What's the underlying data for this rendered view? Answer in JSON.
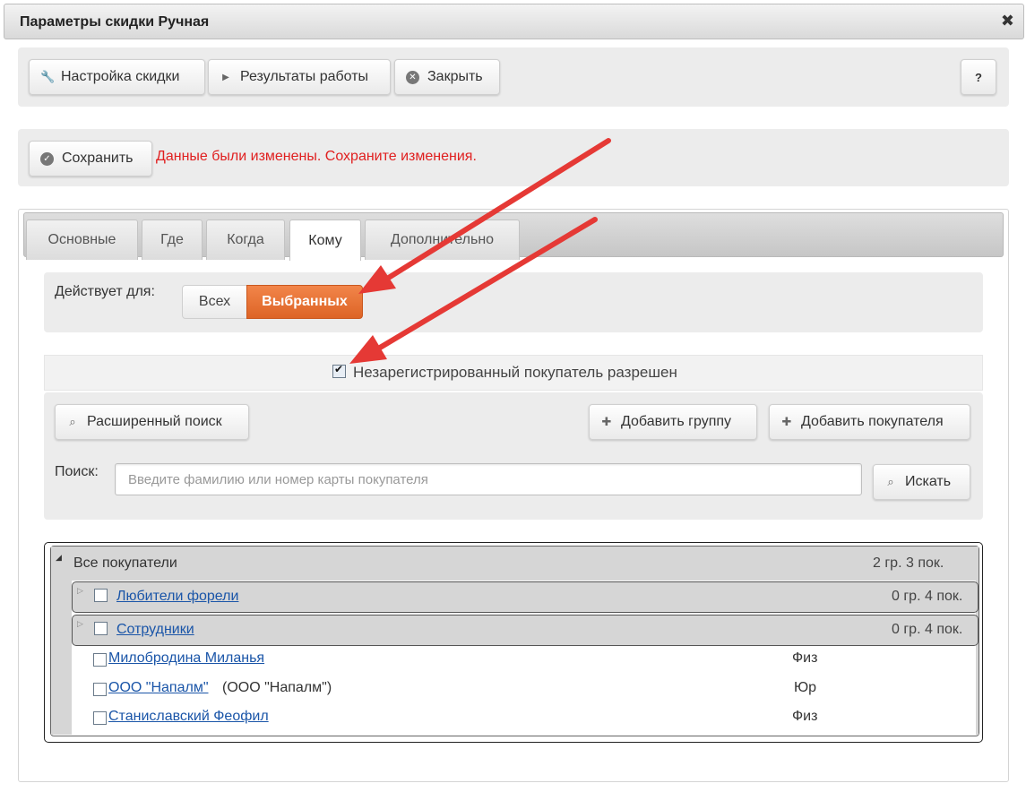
{
  "window": {
    "title": "Параметры скидки Ручная",
    "close_icon": "✖"
  },
  "toolbar": {
    "settings_label": "Настройка скидки",
    "results_label": "Результаты работы",
    "close_label": "Закрыть",
    "help_label": "?"
  },
  "save_bar": {
    "save_label": "Сохранить",
    "notice": "Данные были изменены. Сохраните изменения.",
    "notice_color": "#e02020"
  },
  "tabs": [
    {
      "label": "Основные",
      "active": false
    },
    {
      "label": "Где",
      "active": false
    },
    {
      "label": "Когда",
      "active": false
    },
    {
      "label": "Кому",
      "active": true
    },
    {
      "label": "Дополнительно",
      "active": false
    }
  ],
  "applies_to": {
    "label": "Действует для:",
    "option_all": "Всех",
    "option_selected": "Выбранных",
    "selected": "Выбранных",
    "accent_color": "#e0692b"
  },
  "unregistered": {
    "label": "Незарегистрированный покупатель разрешен",
    "checked": true
  },
  "actions": {
    "advanced_search": "Расширенный поиск",
    "add_group": "Добавить группу",
    "add_customer": "Добавить покупателя"
  },
  "search": {
    "label": "Поиск:",
    "placeholder": "Введите фамилию или номер карты покупателя",
    "button": "Искать"
  },
  "tree": {
    "root_label": "Все покупатели",
    "root_count": "2 гр. 3 пок.",
    "groups": [
      {
        "name": "Любители форели",
        "count": "0 гр. 4 пок."
      },
      {
        "name": "Сотрудники",
        "count": "0 гр. 4 пок."
      }
    ],
    "customers": [
      {
        "name": "Милобродина Миланья",
        "extra": "",
        "type": "Физ"
      },
      {
        "name": "ООО \"Напалм\"",
        "extra": "(ООО \"Напалм\")",
        "type": "Юр"
      },
      {
        "name": "Станиславский Феофил",
        "extra": "",
        "type": "Физ"
      }
    ]
  },
  "annotation_color": "#e53935"
}
